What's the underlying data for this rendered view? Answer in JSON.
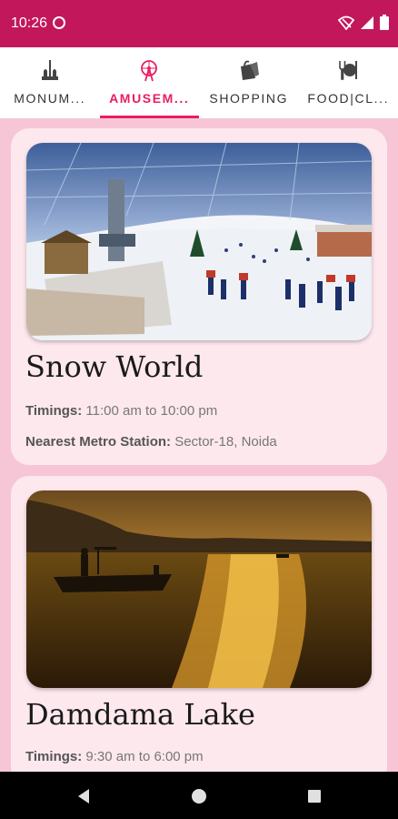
{
  "status": {
    "time": "10:26"
  },
  "tabs": [
    {
      "label": "MONUM...",
      "icon": "monument-icon",
      "active": false
    },
    {
      "label": "AMUSEM...",
      "icon": "amusement-icon",
      "active": true
    },
    {
      "label": "SHOPPING",
      "icon": "shopping-bag-icon",
      "active": false
    },
    {
      "label": "FOOD|CL...",
      "icon": "food-icon",
      "active": false
    }
  ],
  "cards": [
    {
      "title": "Snow World",
      "timings_label": "Timings:",
      "timings_value": "11:00 am to 10:00 pm",
      "metro_label": "Nearest Metro Station:",
      "metro_value": "Sector-18, Noida"
    },
    {
      "title": "Damdama Lake",
      "timings_label": "Timings:",
      "timings_value": "9:30 am to 6:00 pm"
    }
  ],
  "colors": {
    "primary": "#c2185b",
    "accent": "#e91e63",
    "card_bg": "#fde8ee",
    "page_bg": "#f6c6d6"
  }
}
